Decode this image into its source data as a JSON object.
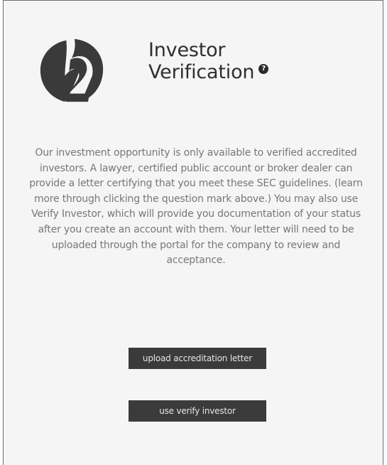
{
  "header": {
    "step_icon": "step-2-icon",
    "title_line1": "Investor",
    "title_line2": "Verification",
    "help_icon": "question-mark-icon",
    "help_glyph": "?"
  },
  "main": {
    "description": "Our investment opportunity is only available to verified accredited investors. A lawyer, certified public account or broker dealer can provide a letter certifying that you meet these SEC guidelines. (learn more through clicking the question mark above.) You may also use Verify Investor, which will provide you documentation of your status after you create an account with them. Your letter will need to be uploaded through the portal for the company to review and acceptance."
  },
  "actions": {
    "upload_label": "upload accreditation letter",
    "verify_label": "use verify investor"
  },
  "colors": {
    "panel_background": "#f5f5f5",
    "logo": "#3a3a3a",
    "title_text": "#2f2f2f",
    "body_text": "#777777",
    "button_background": "#3b3b3b",
    "button_text": "#e6e6e6"
  }
}
